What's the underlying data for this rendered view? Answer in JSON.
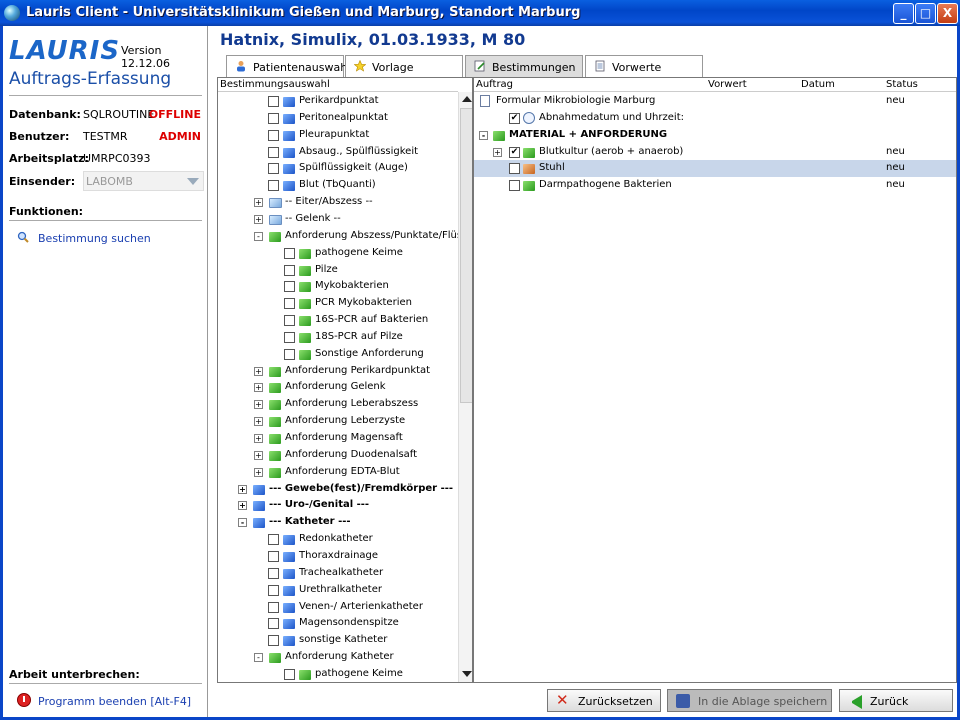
{
  "window": {
    "title": "Lauris Client - Universitätsklinikum Gießen und Marburg, Standort Marburg",
    "buttons": [
      "_",
      "□",
      "X"
    ]
  },
  "sidebar": {
    "logo": "LAURIS",
    "version": "Version 12.12.06",
    "module": "Auftrags-Erfassung",
    "fields": [
      {
        "label": "Datenbank:",
        "value": "SQLROUTINE",
        "flag": "OFFLINE"
      },
      {
        "label": "Benutzer:",
        "value": "TESTMR",
        "flag": "ADMIN"
      },
      {
        "label": "Arbeitsplatz:",
        "value": "UMRPC0393",
        "flag": ""
      }
    ],
    "einsender_label": "Einsender:",
    "einsender_value": "LABOMB",
    "functions_title": "Funktionen:",
    "functions": [
      {
        "label": "Bestimmung suchen"
      }
    ],
    "pause_title": "Arbeit unterbrechen:",
    "exit_label": "Programm beenden [Alt-F4]"
  },
  "patient": "Hatnix, Simulix, 01.03.1933, M 80",
  "tabs": [
    {
      "label": "Patientenauswahl",
      "icon": "person-icon",
      "active": false
    },
    {
      "label": "Vorlage",
      "icon": "star-icon",
      "active": false
    },
    {
      "label": "Bestimmungen",
      "icon": "edit-icon",
      "active": true
    },
    {
      "label": "Vorwerte",
      "icon": "document-icon",
      "active": false
    }
  ],
  "left_panel": {
    "header": "Bestimmungsauswahl",
    "rows": [
      {
        "label": "Perikardpunktat",
        "level": 3,
        "icon": "blue"
      },
      {
        "label": "Peritonealpunktat",
        "level": 3,
        "icon": "blue"
      },
      {
        "label": "Pleurapunktat",
        "level": 3,
        "icon": "blue"
      },
      {
        "label": "Absaug., Spülflüssigkeit",
        "level": 3,
        "icon": "blue"
      },
      {
        "label": "Spülflüssigkeit (Auge)",
        "level": 3,
        "icon": "blue"
      },
      {
        "label": "Blut (TbQuanti)",
        "level": 3,
        "icon": "blue"
      },
      {
        "label": "-- Eiter/Abszess --",
        "level": 2,
        "icon": "folder",
        "expander": "+"
      },
      {
        "label": "-- Gelenk --",
        "level": 2,
        "icon": "folder",
        "expander": "+"
      },
      {
        "label": "Anforderung Abszess/Punktate/Flüssig",
        "level": 2,
        "icon": "green",
        "expander": "-"
      },
      {
        "label": "pathogene Keime",
        "level": 4,
        "icon": "green"
      },
      {
        "label": "Pilze",
        "level": 4,
        "icon": "green"
      },
      {
        "label": "Mykobakterien",
        "level": 4,
        "icon": "green"
      },
      {
        "label": "PCR Mykobakterien",
        "level": 4,
        "icon": "green"
      },
      {
        "label": "16S-PCR auf Bakterien",
        "level": 4,
        "icon": "green"
      },
      {
        "label": "18S-PCR auf Pilze",
        "level": 4,
        "icon": "green"
      },
      {
        "label": "Sonstige Anforderung",
        "level": 4,
        "icon": "green"
      },
      {
        "label": "Anforderung Perikardpunktat",
        "level": 2,
        "icon": "green",
        "expander": "+"
      },
      {
        "label": "Anforderung Gelenk",
        "level": 2,
        "icon": "green",
        "expander": "+"
      },
      {
        "label": "Anforderung Leberabszess",
        "level": 2,
        "icon": "green",
        "expander": "+"
      },
      {
        "label": "Anforderung Leberzyste",
        "level": 2,
        "icon": "green",
        "expander": "+"
      },
      {
        "label": "Anforderung Magensaft",
        "level": 2,
        "icon": "green",
        "expander": "+"
      },
      {
        "label": "Anforderung Duodenalsaft",
        "level": 2,
        "icon": "green",
        "expander": "+"
      },
      {
        "label": "Anforderung EDTA-Blut",
        "level": 2,
        "icon": "green",
        "expander": "+"
      },
      {
        "label": "--- Gewebe(fest)/Fremdkörper ---",
        "level": 1,
        "icon": "blue",
        "expander": "+",
        "bold": true
      },
      {
        "label": "--- Uro-/Genital ---",
        "level": 1,
        "icon": "blue",
        "expander": "+",
        "bold": true
      },
      {
        "label": "--- Katheter ---",
        "level": 1,
        "icon": "blue",
        "expander": "-",
        "bold": true
      },
      {
        "label": "Redonkatheter",
        "level": 3,
        "icon": "blue"
      },
      {
        "label": "Thoraxdrainage",
        "level": 3,
        "icon": "blue"
      },
      {
        "label": "Trachealkatheter",
        "level": 3,
        "icon": "blue"
      },
      {
        "label": "Urethralkatheter",
        "level": 3,
        "icon": "blue"
      },
      {
        "label": "Venen-/ Arterienkatheter",
        "level": 3,
        "icon": "blue"
      },
      {
        "label": "Magensondenspitze",
        "level": 3,
        "icon": "blue"
      },
      {
        "label": "sonstige Katheter",
        "level": 3,
        "icon": "blue"
      },
      {
        "label": "Anforderung Katheter",
        "level": 2,
        "icon": "green",
        "expander": "-"
      },
      {
        "label": "pathogene Keime",
        "level": 4,
        "icon": "green"
      }
    ]
  },
  "right_panel": {
    "columns": [
      "Auftrag",
      "Vorwert",
      "Datum",
      "Status"
    ],
    "rows": [
      {
        "label": "Formular Mikrobiologie Marburg",
        "level": 0,
        "icon": "doc",
        "status": "neu"
      },
      {
        "label": "Abnahmedatum und Uhrzeit:",
        "level": 1,
        "icon": "clock",
        "checkbox": true,
        "checked": true,
        "status": ""
      },
      {
        "label": "MATERIAL + ANFORDERUNG",
        "level": 0,
        "icon": "green",
        "expander": "-",
        "bold": true,
        "status": ""
      },
      {
        "label": "Blutkultur (aerob + anaerob)",
        "level": 1,
        "icon": "green",
        "expander": "+",
        "checkbox": true,
        "checked": true,
        "status": "neu"
      },
      {
        "label": "Stuhl",
        "level": 1,
        "icon": "orange",
        "checkbox": true,
        "checked": false,
        "status": "neu",
        "selected": true
      },
      {
        "label": "Darmpathogene Bakterien",
        "level": 1,
        "icon": "green",
        "checkbox": true,
        "checked": false,
        "status": "neu"
      }
    ]
  },
  "buttons": {
    "reset": "Zurücksetzen",
    "save": "In die Ablage speichern",
    "back": "Zurück"
  }
}
